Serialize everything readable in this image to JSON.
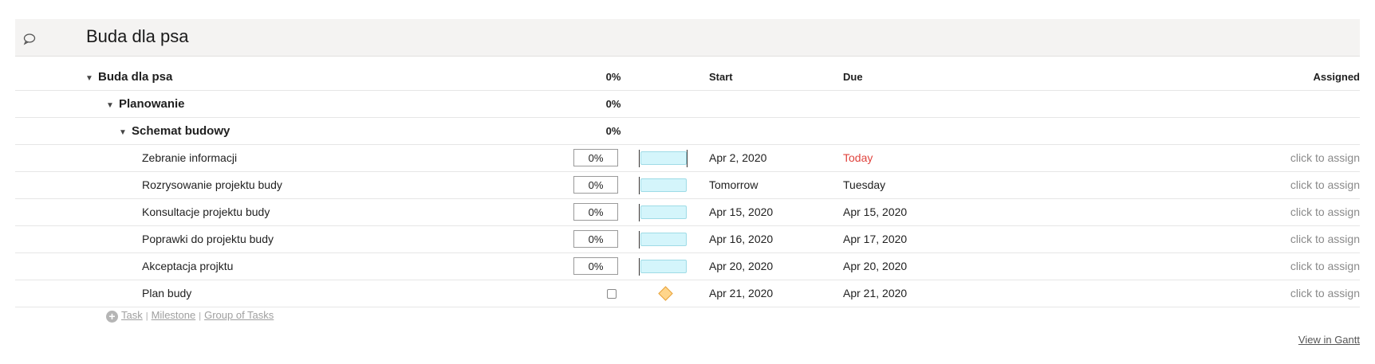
{
  "header": {
    "title": "Buda dla psa"
  },
  "columns": {
    "start": "Start",
    "due": "Due",
    "assigned": "Assigned"
  },
  "groups": [
    {
      "name": "Buda dla psa",
      "progress": "0%",
      "level": 0
    },
    {
      "name": "Planowanie",
      "progress": "0%",
      "level": 1
    },
    {
      "name": "Schemat budowy",
      "progress": "0%",
      "level": 2
    }
  ],
  "tasks": [
    {
      "name": "Zebranie informacji",
      "progress": "0%",
      "start": "Apr 2, 2020",
      "due": "Today",
      "assign": "click to assign"
    },
    {
      "name": "Rozrysowanie projektu budy",
      "progress": "0%",
      "start": "Tomorrow",
      "due": "Tuesday",
      "assign": "click to assign"
    },
    {
      "name": "Konsultacje projektu budy",
      "progress": "0%",
      "start": "Apr 15, 2020",
      "due": "Apr 15, 2020",
      "assign": "click to assign"
    },
    {
      "name": "Poprawki do projektu budy",
      "progress": "0%",
      "start": "Apr 16, 2020",
      "due": "Apr 17, 2020",
      "assign": "click to assign"
    },
    {
      "name": "Akceptacja projktu",
      "progress": "0%",
      "start": "Apr 20, 2020",
      "due": "Apr 20, 2020",
      "assign": "click to assign"
    }
  ],
  "milestone": {
    "name": "Plan budy",
    "start": "Apr 21, 2020",
    "due": "Apr 21, 2020",
    "assign": "click to assign"
  },
  "add_links": {
    "task": "Task",
    "milestone": "Milestone",
    "group": "Group of Tasks",
    "separator": "|"
  },
  "footer": {
    "gantt_link": "View in Gantt"
  },
  "colors": {
    "today": "#e0443e",
    "bar_fill": "#d4f5fb",
    "milestone_fill": "#ffd58a"
  }
}
